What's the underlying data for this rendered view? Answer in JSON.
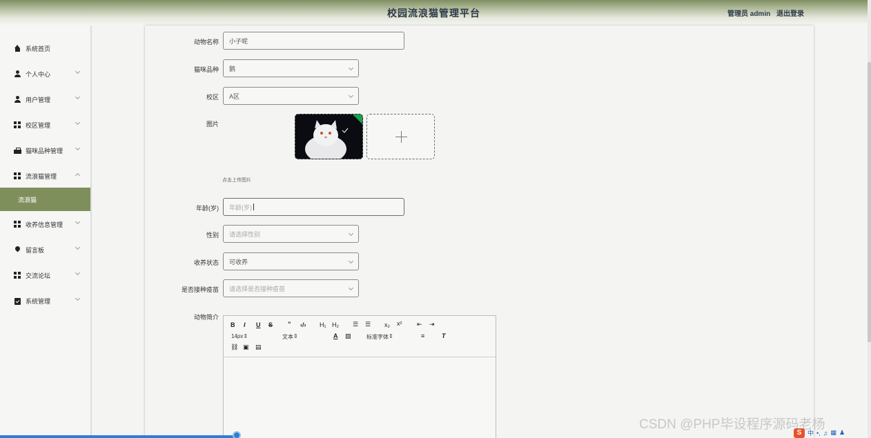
{
  "header": {
    "title": "校园流浪猫管理平台",
    "user": "管理员 admin",
    "logout": "退出登录"
  },
  "sidebar": {
    "items": [
      {
        "label": "系统首页",
        "icon": "home-icon"
      },
      {
        "label": "个人中心",
        "icon": "user-icon"
      },
      {
        "label": "用户管理",
        "icon": "user-icon"
      },
      {
        "label": "校区管理",
        "icon": "grid-icon"
      },
      {
        "label": "猫咪品种管理",
        "icon": "briefcase-icon"
      },
      {
        "label": "流浪猫管理",
        "icon": "grid-icon",
        "expanded": true
      },
      {
        "label": "收养信息管理",
        "icon": "grid-icon"
      },
      {
        "label": "留言板",
        "icon": "pin-icon"
      },
      {
        "label": "交流论坛",
        "icon": "grid-icon"
      },
      {
        "label": "系统管理",
        "icon": "clipboard-icon"
      }
    ],
    "active_subitem": "流浪猫"
  },
  "form": {
    "name": {
      "label": "动物名称",
      "value": "小子呢"
    },
    "breed": {
      "label": "猫咪品种",
      "value": "鹅"
    },
    "campus": {
      "label": "校区",
      "value": "A区"
    },
    "image": {
      "label": "图片",
      "hint": "点击上传图片"
    },
    "age": {
      "label": "年龄(岁)",
      "placeholder": "年龄(岁)"
    },
    "gender": {
      "label": "性别",
      "placeholder": "请选择性别"
    },
    "adopt_status": {
      "label": "收养状态",
      "value": "可收养"
    },
    "vaccinated": {
      "label": "是否接种疫苗",
      "placeholder": "请选择是否接种疫苗"
    },
    "intro": {
      "label": "动物简介"
    }
  },
  "editor": {
    "font_size": "14px",
    "text_type": "文本",
    "font_family": "标准字体"
  },
  "watermark": "CSDN @PHP毕设程序源码老杨",
  "ime": {
    "label": "中"
  }
}
